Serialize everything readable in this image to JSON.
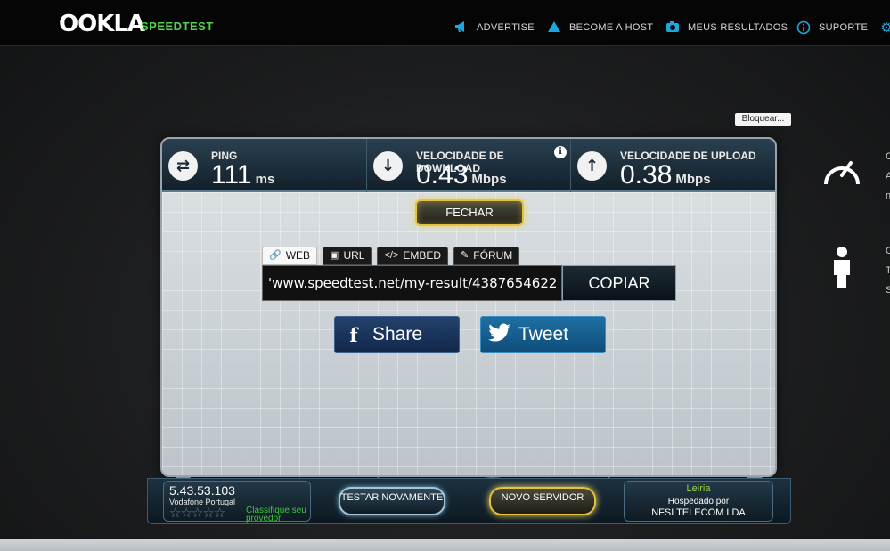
{
  "brand": {
    "logo": "OOKLA",
    "product": "SPEEDTEST"
  },
  "nav": [
    {
      "label": "ADVERTISE",
      "icon": "megaphone-icon"
    },
    {
      "label": "BECOME A HOST",
      "icon": "triangle-icon"
    },
    {
      "label": "MEUS RESULTADOS",
      "icon": "camera-icon"
    },
    {
      "label": "SUPORTE",
      "icon": "info-icon"
    }
  ],
  "block_label": "Bloquear...",
  "metrics": {
    "ping": {
      "label": "PING",
      "value": "111",
      "unit": "ms"
    },
    "download": {
      "label": "VELOCIDADE DE DOWNLOAD",
      "value": "0.43",
      "unit": "Mbps"
    },
    "upload": {
      "label": "VELOCIDADE DE UPLOAD",
      "value": "0.38",
      "unit": "Mbps"
    }
  },
  "close_label": "FECHAR",
  "share_tabs": [
    {
      "label": "WEB",
      "icon": "link-icon",
      "active": true
    },
    {
      "label": "URL",
      "icon": "image-icon",
      "active": false
    },
    {
      "label": "EMBED",
      "icon": "code-icon",
      "active": false
    },
    {
      "label": "FÓRUM",
      "icon": "edit-icon",
      "active": false
    }
  ],
  "share_url": "'www.speedtest.net/my-result/4387654622",
  "copy_label": "COPIAR",
  "social": {
    "facebook": "Share",
    "twitter": "Tweet"
  },
  "client": {
    "ip": "5.43.53.103",
    "isp": "Vodafone Portugal",
    "rating": 0,
    "rate_label": "Classifique seu provedor"
  },
  "actions": {
    "retest": "TESTAR NOVAMENTE",
    "new_server": "NOVO SERVIDOR"
  },
  "server": {
    "city": "Leiria",
    "hosted_by": "Hospedado por",
    "name": "NFSI TELECOM LDA"
  },
  "colors": {
    "accent_green": "#53d34d",
    "nav_icon": "#1fa6dc",
    "gold": "#e4c23f",
    "map_blue": "#1ea8e0"
  }
}
